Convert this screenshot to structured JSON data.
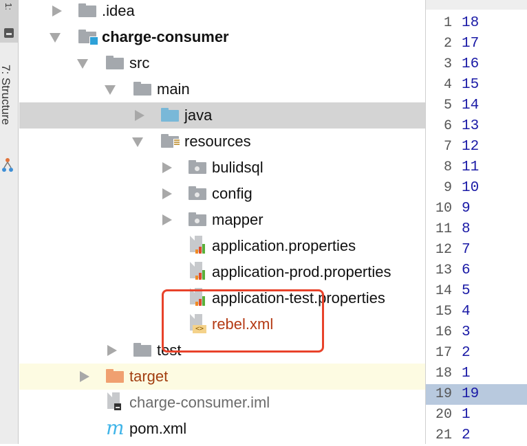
{
  "tool_strip": {
    "project_tab": "1:",
    "structure_tab": "7: Structure"
  },
  "tree": {
    "rows": [
      {
        "label": ".idea"
      },
      {
        "label": "charge-consumer"
      },
      {
        "label": "src"
      },
      {
        "label": "main"
      },
      {
        "label": "java"
      },
      {
        "label": "resources"
      },
      {
        "label": "bulidsql"
      },
      {
        "label": "config"
      },
      {
        "label": "mapper"
      },
      {
        "label": "application.properties"
      },
      {
        "label": "application-prod.properties"
      },
      {
        "label": "application-test.properties"
      },
      {
        "label": "rebel.xml"
      },
      {
        "label": "test"
      },
      {
        "label": "target"
      },
      {
        "label": "charge-consumer.iml"
      },
      {
        "label": "pom.xml"
      }
    ],
    "pom_icon_letter": "m",
    "xml_icon_glyph": "<>"
  },
  "side_list": {
    "rows": [
      {
        "line": "1",
        "value": "18"
      },
      {
        "line": "2",
        "value": "17"
      },
      {
        "line": "3",
        "value": "16"
      },
      {
        "line": "4",
        "value": "15"
      },
      {
        "line": "5",
        "value": "14"
      },
      {
        "line": "6",
        "value": "13"
      },
      {
        "line": "7",
        "value": "12"
      },
      {
        "line": "8",
        "value": "11"
      },
      {
        "line": "9",
        "value": "10"
      },
      {
        "line": "10",
        "value": "9"
      },
      {
        "line": "11",
        "value": "8"
      },
      {
        "line": "12",
        "value": "7"
      },
      {
        "line": "13",
        "value": "6"
      },
      {
        "line": "14",
        "value": "5"
      },
      {
        "line": "15",
        "value": "4"
      },
      {
        "line": "16",
        "value": "3"
      },
      {
        "line": "17",
        "value": "2"
      },
      {
        "line": "18",
        "value": "1"
      },
      {
        "line": "19",
        "value": "19"
      },
      {
        "line": "20",
        "value": "1"
      },
      {
        "line": "21",
        "value": "2"
      }
    ]
  },
  "colors": {
    "selection": "#d4d4d4",
    "highlight_row": "#fdfbe2",
    "annotation_box": "#e8422a",
    "side_selected": "#b8c9de",
    "value_text": "#1a1aa6"
  }
}
